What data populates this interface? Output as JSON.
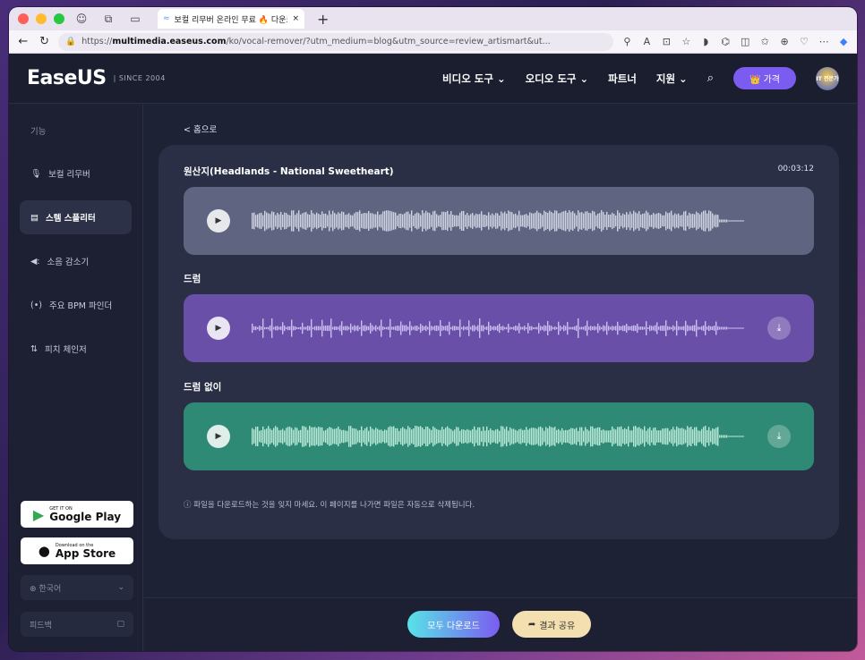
{
  "browser": {
    "tab_title": "보컬 리무버 온라인 무료 🔥 다운로드",
    "new_tab": "+",
    "url_prefix": "https://",
    "url_host": "multimedia.easeus.com",
    "url_path": "/ko/vocal-remover/?utm_medium=blog&utm_source=review_artismart&ut..."
  },
  "header": {
    "logo": "EaseUS",
    "since": "| SINCE 2004",
    "menu": [
      "비디오 도구 ⌄",
      "오디오 도구 ⌄",
      "파트너",
      "지원 ⌄"
    ],
    "price_button": "👑 가격",
    "avatar_text": "IT 전문가"
  },
  "sidebar": {
    "heading": "기능",
    "items": [
      {
        "icon": "🎙",
        "label": "보컬 리무버"
      },
      {
        "icon": "▤",
        "label": "스템 스플리터"
      },
      {
        "icon": "◀:",
        "label": "소음 감소기"
      },
      {
        "icon": "(•)",
        "label": "주요 BPM 파인더"
      },
      {
        "icon": "⇅",
        "label": "피치 체인저"
      }
    ],
    "google_play_small": "GET IT ON",
    "google_play_large": "Google Play",
    "app_store_small": "Download on the",
    "app_store_large": "App Store",
    "language": "⊕ 한국어",
    "feedback": "피드백"
  },
  "main": {
    "back_link": "< 홈으로",
    "tracks": [
      {
        "label": "원산지(Headlands - National Sweetheart)",
        "duration": "00:03:12",
        "color": "#5f6580",
        "wave_color": "#cfd3e2"
      },
      {
        "label": "드럼",
        "color": "#6a4fa8",
        "wave_color": "#c9bff0"
      },
      {
        "label": "드럼 없이",
        "color": "#2f8a75",
        "wave_color": "#b9e8d8"
      }
    ],
    "notice": "ⓘ  파일을 다운로드하는 것을 잊지 마세요. 이 페이지를 나가면 파일은 자동으로 삭제됩니다.",
    "download_all": "모두 다운로드",
    "share": "결과 공유"
  }
}
